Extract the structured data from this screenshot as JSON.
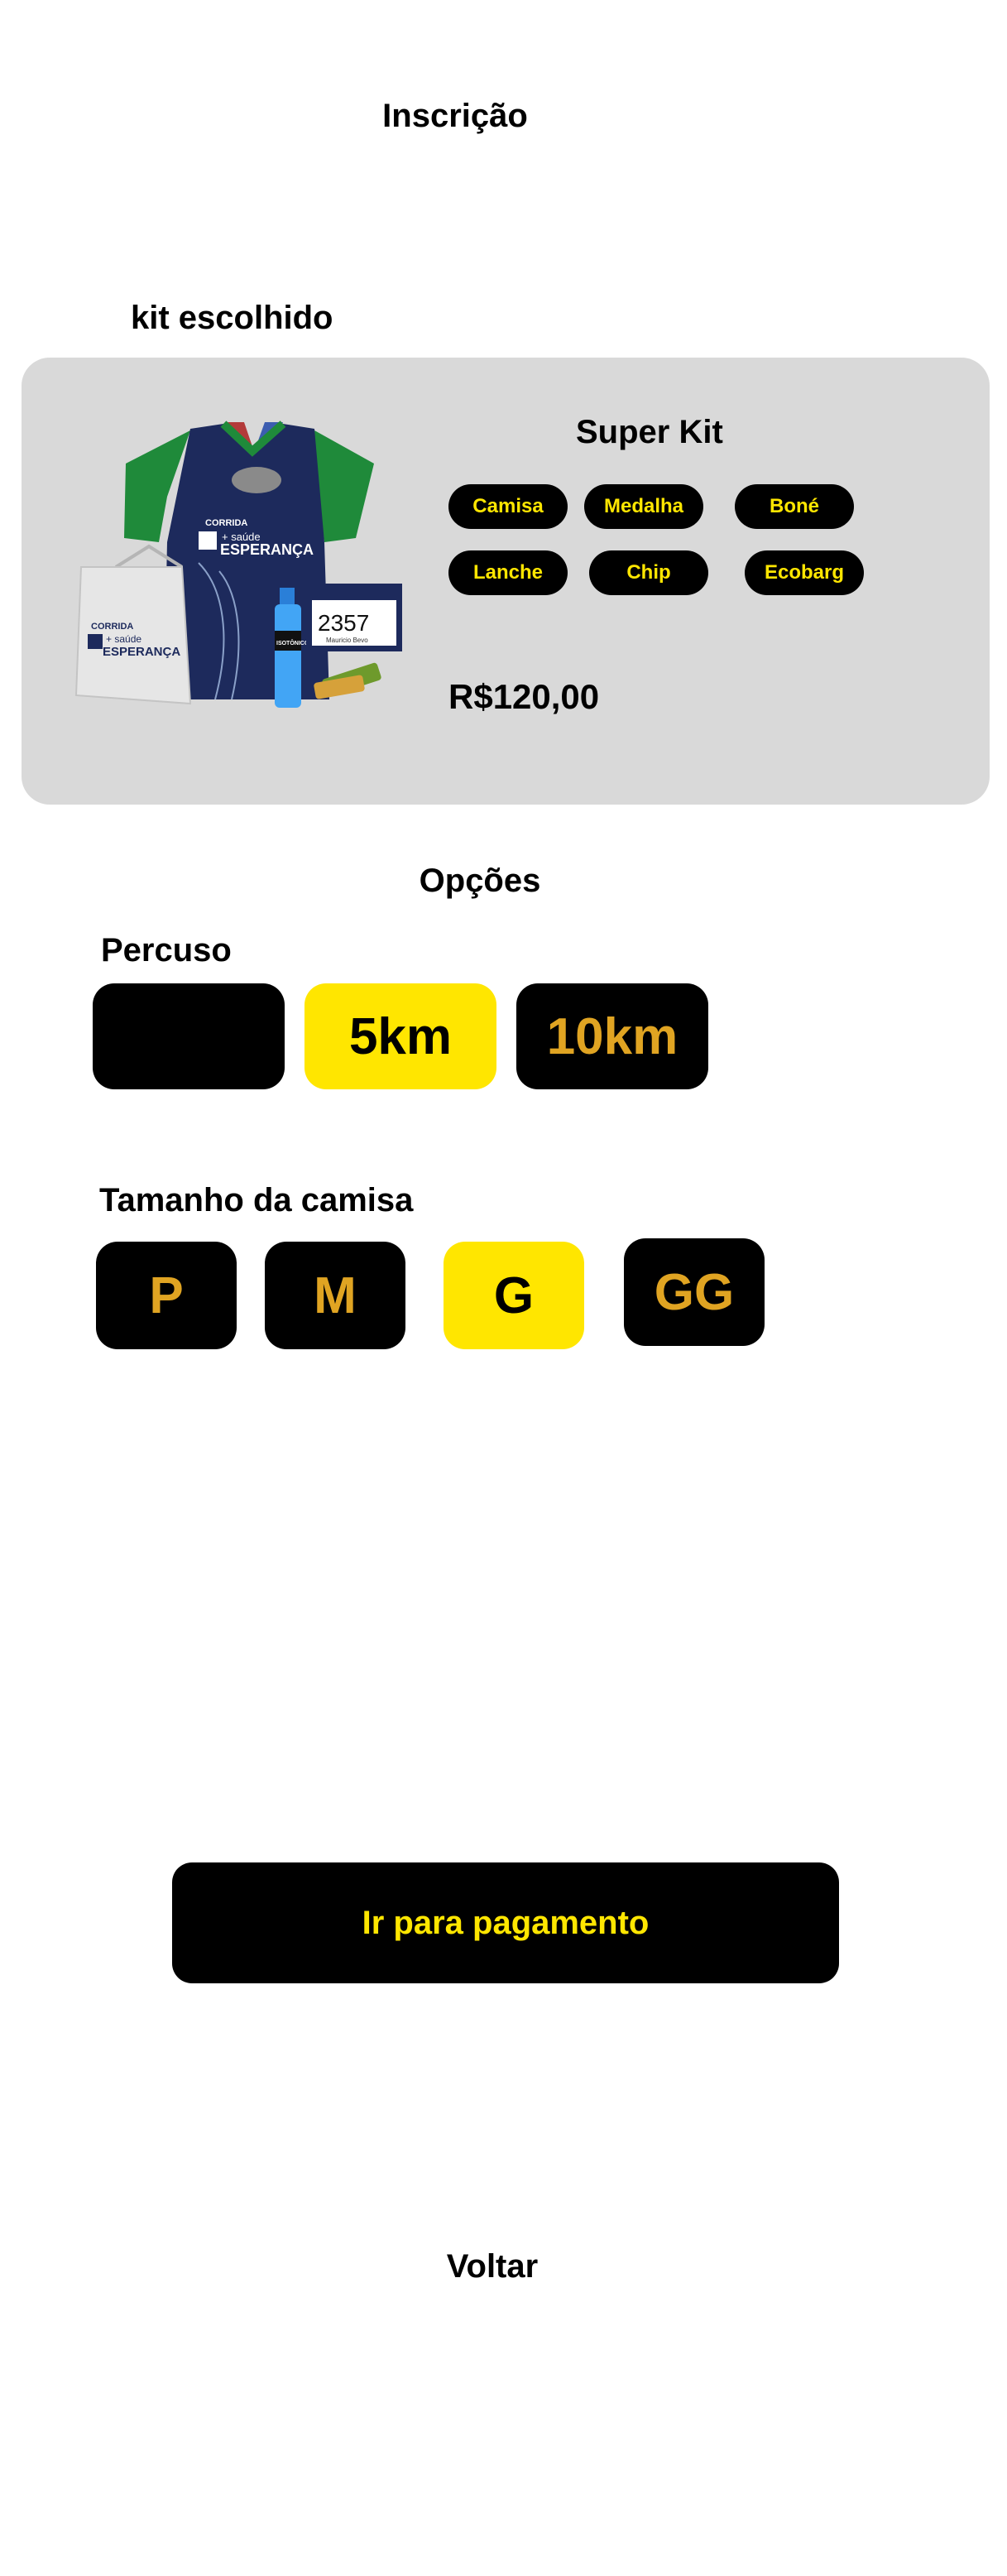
{
  "page": {
    "title": "Inscrição"
  },
  "kit": {
    "section_label": "kit escolhido",
    "name": "Super Kit",
    "items": [
      "Camisa",
      "Medalha",
      "Boné",
      "Lanche",
      "Chip",
      "Ecobarg"
    ],
    "price": "R$120,00",
    "image": {
      "bag_text": [
        "CORRIDA",
        "+ saúde",
        "ESPERANÇA"
      ],
      "shirt_text": [
        "CORRIDA",
        "+ saúde",
        "ESPERANÇA"
      ],
      "bottle_label": "ISOTÔNICO",
      "bib_number": "2357",
      "bib_name": "Mauricio Bevo"
    }
  },
  "options": {
    "section_title": "Opções",
    "route": {
      "label": "Percuso",
      "choices": [
        "",
        "5km",
        "10km"
      ],
      "selected": "5km"
    },
    "shirt_size": {
      "label": "Tamanho da camisa",
      "choices": [
        "P",
        "M",
        "G",
        "GG"
      ],
      "selected": "G"
    }
  },
  "actions": {
    "pay_label": "Ir para pagamento",
    "back_label": "Voltar"
  },
  "colors": {
    "accent": "#ffe600",
    "option_text": "#e0a422",
    "card": "#d9d9d9",
    "dark": "#000000"
  }
}
